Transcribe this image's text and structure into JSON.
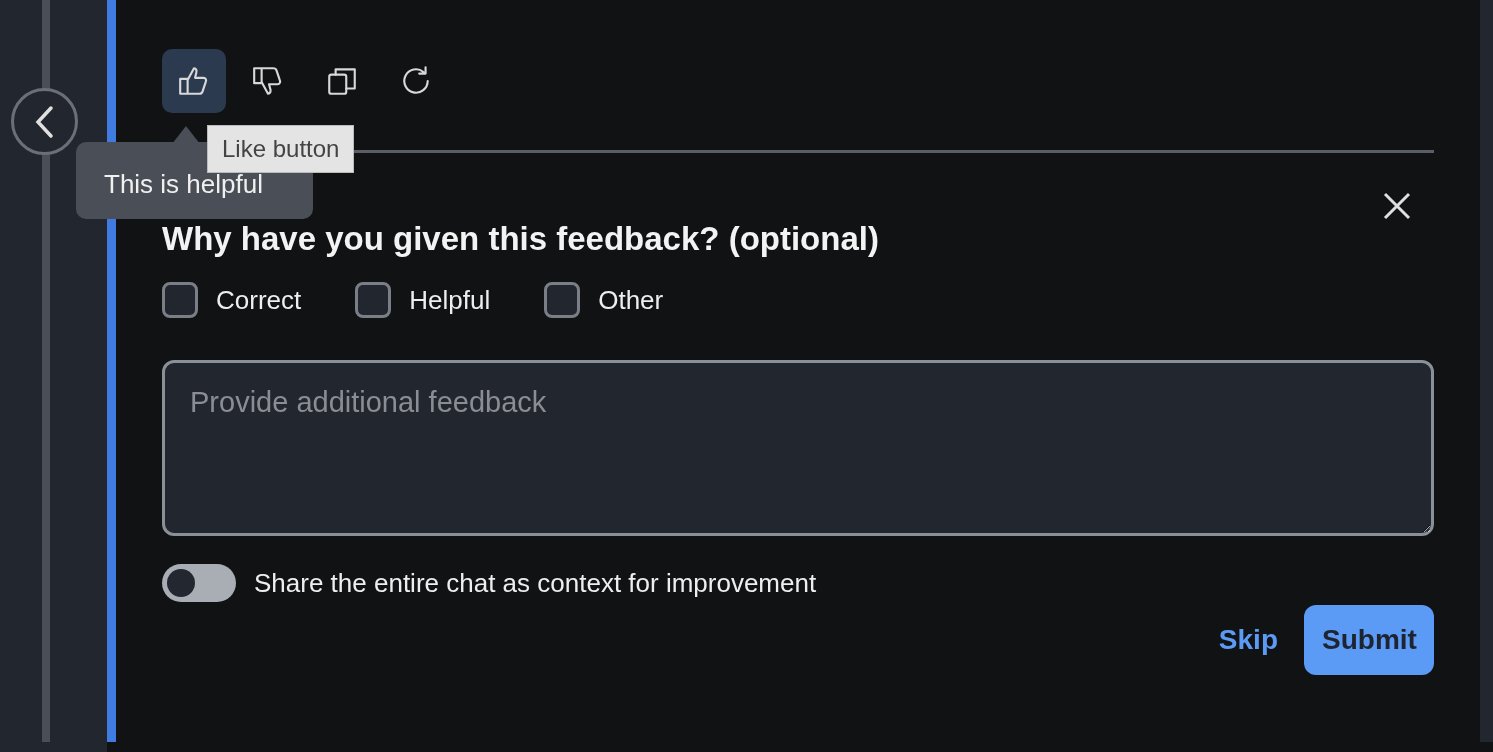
{
  "sidebar": {
    "collapse_button": {
      "expanded": true
    }
  },
  "toolbar": [
    {
      "kind": "like",
      "selected": true
    },
    {
      "kind": "dislike",
      "selected": false
    },
    {
      "kind": "copy",
      "selected": false
    },
    {
      "kind": "regenerate",
      "selected": false
    }
  ],
  "tooltips": [
    {
      "kind": "hint",
      "text": "This is helpful"
    },
    {
      "kind": "native",
      "text": "Like button"
    }
  ],
  "feedback": {
    "title": "Why have you given this feedback? (optional)",
    "options": [
      {
        "label": "Correct",
        "checked": false
      },
      {
        "label": "Helpful",
        "checked": false
      },
      {
        "label": "Other",
        "checked": false
      }
    ],
    "comment": {
      "placeholder": "Provide additional feedback"
    },
    "share_toggle": {
      "label": "Share the entire chat as context for improvement",
      "on": false
    },
    "actions": [
      {
        "kind": "link",
        "label": "Skip"
      },
      {
        "kind": "primary",
        "label": "Submit"
      }
    ]
  }
}
